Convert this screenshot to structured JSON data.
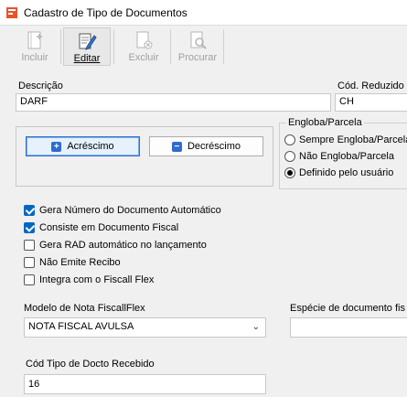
{
  "window": {
    "title": "Cadastro de Tipo de Documentos"
  },
  "toolbar": {
    "incluir": "Incluir",
    "editar": "Editar",
    "excluir": "Excluir",
    "procurar": "Procurar"
  },
  "form": {
    "descricao_label": "Descrição",
    "descricao_value": "DARF",
    "cod_reduzido_label": "Cód. Reduzido",
    "cod_reduzido_value": "CH",
    "acrescimo_label": "Acréscimo",
    "decrescimo_label": "Decréscimo",
    "engloba": {
      "title": "Engloba/Parcela",
      "options": [
        "Sempre Engloba/Parcela",
        "Não Engloba/Parcela",
        "Definido pelo usuário"
      ],
      "selected": "Definido pelo usuário"
    },
    "checks": [
      {
        "label": "Gera Número do Documento Automático",
        "checked": true
      },
      {
        "label": "Consiste em Documento Fiscal",
        "checked": true
      },
      {
        "label": "Gera RAD automático no lançamento",
        "checked": false
      },
      {
        "label": "Não Emite Recibo",
        "checked": false
      },
      {
        "label": "Integra com o Fiscall Flex",
        "checked": false
      }
    ],
    "modelo_label": "Modelo de Nota FiscallFlex",
    "modelo_value": "NOTA FISCAL AVULSA",
    "especie_label": "Espécie de documento fis",
    "especie_value": "",
    "cod_tipo_label": "Cód Tipo de Docto Recebido",
    "cod_tipo_value": "16"
  },
  "colors": {
    "accent": "#0067c0",
    "add_icon": "#2f6bd0",
    "remove_icon": "#2f6bd0"
  }
}
